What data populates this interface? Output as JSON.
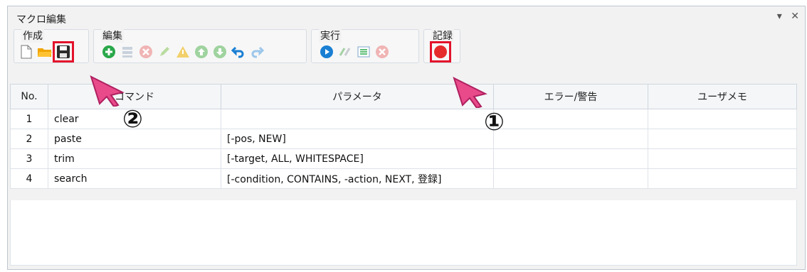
{
  "window": {
    "title": "マクロ編集",
    "controls": [
      "▾",
      "✕"
    ]
  },
  "toolbar": {
    "groups": [
      {
        "label": "作成",
        "icons": [
          "new-file-icon",
          "open-folder-icon",
          "save-icon"
        ]
      },
      {
        "label": "編集",
        "icons": [
          "add-icon",
          "insert-icon",
          "delete-icon",
          "edit-icon",
          "warning-icon",
          "move-up-icon",
          "move-down-icon",
          "undo-icon",
          "redo-icon"
        ]
      },
      {
        "label": "実行",
        "icons": [
          "play-icon",
          "step-icon",
          "run-selection-icon",
          "stop-icon"
        ]
      },
      {
        "label": "記録",
        "icons": [
          "record-icon"
        ]
      }
    ]
  },
  "table": {
    "headers": [
      "No.",
      "コマンド",
      "パラメータ",
      "エラー/警告",
      "ユーザメモ"
    ],
    "rows": [
      {
        "no": "1",
        "command": "clear",
        "params": "",
        "error": "",
        "memo": ""
      },
      {
        "no": "2",
        "command": "paste",
        "params": "[-pos, NEW]",
        "error": "",
        "memo": ""
      },
      {
        "no": "3",
        "command": "trim",
        "params": "[-target, ALL, WHITESPACE]",
        "error": "",
        "memo": ""
      },
      {
        "no": "4",
        "command": "search",
        "params": "[-condition, CONTAINS, -action, NEXT, 登録]",
        "error": "",
        "memo": ""
      }
    ]
  },
  "annotations": {
    "step1": "①",
    "step2": "②"
  },
  "colors": {
    "highlight": "#e3122b",
    "accent_blue": "#1a7fd3",
    "green": "#2aa84a",
    "record": "#e52b2b"
  }
}
